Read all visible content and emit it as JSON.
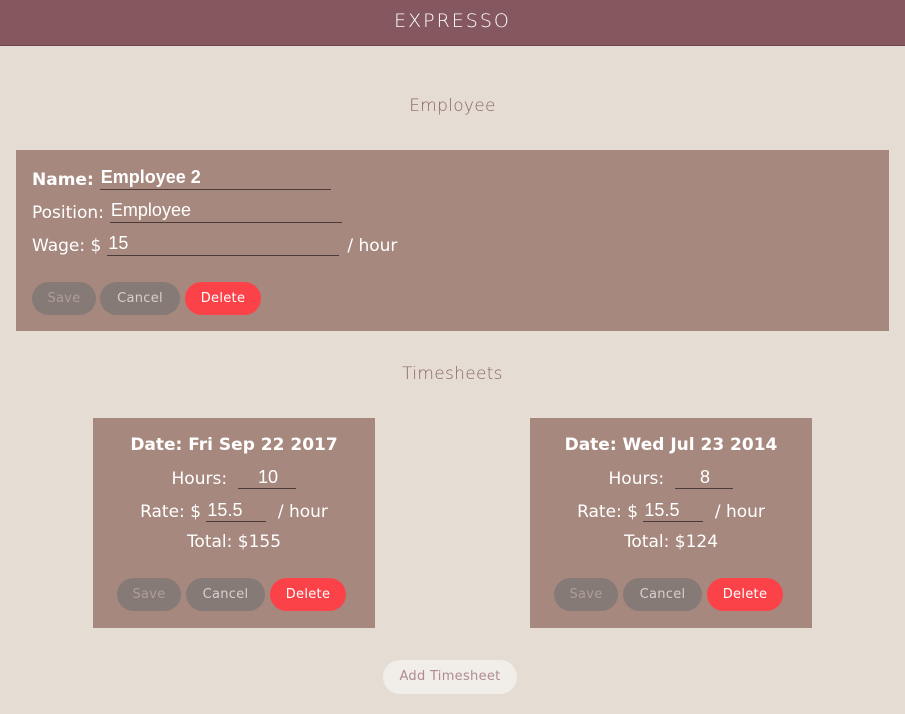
{
  "app": {
    "brand": "EXPRESSO"
  },
  "employee": {
    "section_title": "Employee",
    "name_label": "Name:",
    "name_value": "Employee 2",
    "position_label": "Position:",
    "position_value": "Employee",
    "wage_label": "Wage: $",
    "wage_value": "15",
    "wage_suffix": "/ hour",
    "buttons": {
      "save": "Save",
      "cancel": "Cancel",
      "delete": "Delete"
    }
  },
  "timesheets": {
    "section_title": "Timesheets",
    "hours_label": "Hours:",
    "rate_label": "Rate: $",
    "rate_suffix": "/ hour",
    "total_label": "Total:",
    "items": [
      {
        "date": "Date: Fri Sep 22 2017",
        "hours": "10",
        "rate": "15.5",
        "total": "$155"
      },
      {
        "date": "Date: Wed Jul 23 2014",
        "hours": "8",
        "rate": "15.5",
        "total": "$124"
      }
    ],
    "buttons": {
      "save": "Save",
      "cancel": "Cancel",
      "delete": "Delete"
    },
    "add_label": "Add Timesheet"
  },
  "colors": {
    "header": "#85575f",
    "background": "#e5ddd4",
    "card": "#a6887e",
    "delete_button": "#fa4248",
    "neutral_button": "#857a76"
  }
}
